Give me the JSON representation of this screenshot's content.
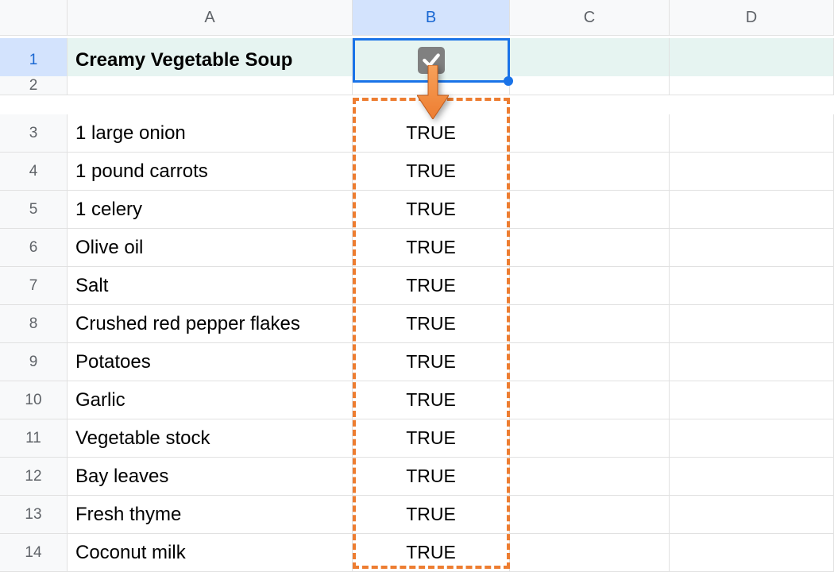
{
  "columns": [
    "A",
    "B",
    "C",
    "D"
  ],
  "activeColumn": "B",
  "activeRow": 1,
  "rows": [
    {
      "n": 1,
      "a": "Creamy Vegetable Soup",
      "b_type": "checkbox"
    },
    {
      "n": 2,
      "a": "",
      "b": ""
    },
    {
      "n": 3,
      "a": "1 large onion",
      "b": "TRUE"
    },
    {
      "n": 4,
      "a": "1 pound carrots",
      "b": "TRUE"
    },
    {
      "n": 5,
      "a": "1 celery",
      "b": "TRUE"
    },
    {
      "n": 6,
      "a": "Olive oil",
      "b": "TRUE"
    },
    {
      "n": 7,
      "a": "Salt",
      "b": "TRUE"
    },
    {
      "n": 8,
      "a": "Crushed red pepper flakes",
      "b": "TRUE"
    },
    {
      "n": 9,
      "a": "Potatoes",
      "b": "TRUE"
    },
    {
      "n": 10,
      "a": "Garlic",
      "b": "TRUE"
    },
    {
      "n": 11,
      "a": "Vegetable stock",
      "b": "TRUE"
    },
    {
      "n": 12,
      "a": "Bay leaves",
      "b": "TRUE"
    },
    {
      "n": 13,
      "a": "Fresh thyme",
      "b": "TRUE"
    },
    {
      "n": 14,
      "a": "Coconut milk",
      "b": "TRUE"
    }
  ]
}
